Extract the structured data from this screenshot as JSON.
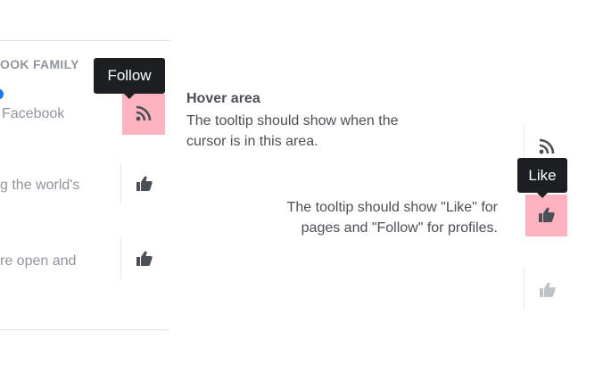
{
  "left_panel": {
    "section_title": "OOK FAMILY",
    "rows": [
      {
        "text": "Facebook",
        "action_icon": "rss-icon",
        "hovered": true
      },
      {
        "text": "g the world's",
        "action_icon": "thumbs-up-icon",
        "hovered": false
      },
      {
        "text": "re open and",
        "action_icon": "thumbs-up-icon",
        "hovered": false
      }
    ],
    "tooltip": "Follow"
  },
  "annotations": {
    "hover_title": "Hover area",
    "hover_line1": "The tooltip should show when the",
    "hover_line2": "cursor is in this area.",
    "tooltip_line1": "The tooltip should show \"Like\" for",
    "tooltip_line2": "pages and \"Follow\" for profiles."
  },
  "right_panel": {
    "icons": [
      "rss-icon",
      "thumbs-up-icon",
      "thumbs-up-icon"
    ],
    "tooltip": "Like"
  },
  "colors": {
    "hover_area": "#ffb3c1",
    "tooltip_bg": "#1c1e21",
    "icon_dark": "#4b4f56",
    "icon_light": "#bec2c9",
    "blue_dot": "#1877f2"
  }
}
